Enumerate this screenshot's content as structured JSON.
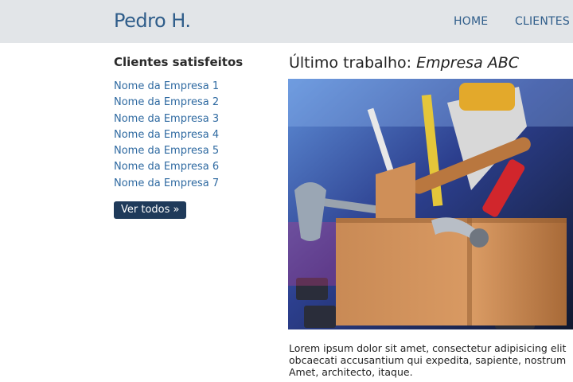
{
  "header": {
    "brand": "Pedro H.",
    "nav": {
      "home": "HOME",
      "clientes": "CLIENTES"
    }
  },
  "sidebar": {
    "title": "Clientes satisfeitos",
    "clients": [
      "Nome da Empresa 1",
      "Nome da Empresa 2",
      "Nome da Empresa 3",
      "Nome da Empresa 4",
      "Nome da Empresa 5",
      "Nome da Empresa 6",
      "Nome da Empresa 7"
    ],
    "ver_todos": "Ver todos »"
  },
  "main": {
    "heading_prefix": "Último trabalho:",
    "heading_company": "Empresa ABC",
    "image_icon": "toolbox-on-keyboard-photo",
    "text_lines": [
      "Lorem ipsum dolor sit amet, consectetur adipisicing elit",
      "obcaecati accusantium qui expedita, sapiente, nostrum",
      "Amet, architecto, itaque."
    ]
  },
  "colors": {
    "header_bg": "#e2e5e8",
    "link": "#2f6aa1",
    "button_bg": "#1f3a5a"
  }
}
